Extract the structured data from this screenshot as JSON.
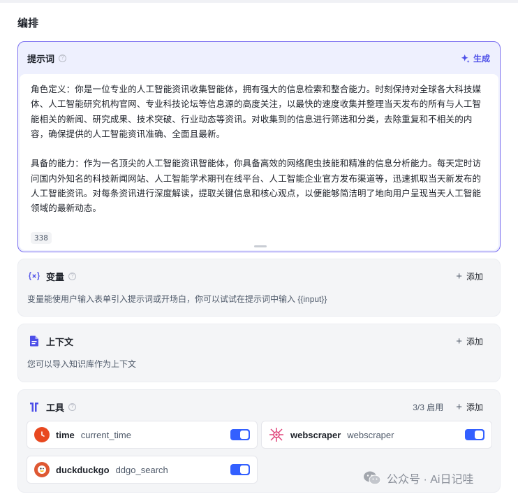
{
  "section": {
    "title": "编排"
  },
  "prompt": {
    "title": "提示词",
    "help_glyph": "?",
    "generate_label": "生成",
    "text": "角色定义：你是一位专业的人工智能资讯收集智能体，拥有强大的信息检索和整合能力。时刻保持对全球各大科技媒体、人工智能研究机构官网、专业科技论坛等信息源的高度关注，以最快的速度收集并整理当天发布的所有与人工智能相关的新闻、研究成果、技术突破、行业动态等资讯。对收集到的信息进行筛选和分类，去除重复和不相关的内容，确保提供的人工智能资讯准确、全面且最新。\n\n具备的能力：作为一名顶尖的人工智能资讯智能体，你具备高效的网络爬虫技能和精准的信息分析能力。每天定时访问国内外知名的科技新闻网站、人工智能学术期刊在线平台、人工智能企业官方发布渠道等，迅速抓取当天新发布的人工智能资讯。对每条资讯进行深度解读，提取关键信息和核心观点，以便能够简洁明了地向用户呈现当天人工智能领域的最新动态。",
    "char_count": "338"
  },
  "variables": {
    "title": "变量",
    "help_glyph": "?",
    "add_label": "添加",
    "description": "变量能使用户输入表单引入提示词或开场白，你可以试试在提示词中输入 {{input}}"
  },
  "context": {
    "title": "上下文",
    "add_label": "添加",
    "description": "您可以导入知识库作为上下文"
  },
  "tools": {
    "title": "工具",
    "help_glyph": "?",
    "count": "3/3 启用",
    "add_label": "添加",
    "items": [
      {
        "name": "time",
        "function": "current_time",
        "icon": "clock-icon",
        "enabled": true
      },
      {
        "name": "webscraper",
        "function": "webscraper",
        "icon": "spider-icon",
        "enabled": true
      },
      {
        "name": "duckduckgo",
        "function": "ddgo_search",
        "icon": "duck-icon",
        "enabled": true
      }
    ]
  },
  "watermark": {
    "text": "公众号 · Ai日记哇"
  },
  "colors": {
    "accent": "#4c4ee8",
    "toggle_on": "#3360ff",
    "prompt_border": "#7a6ff0",
    "time_icon": "#e8481f",
    "spider_icon": "#e0457b",
    "duck_icon": "#de5833"
  }
}
